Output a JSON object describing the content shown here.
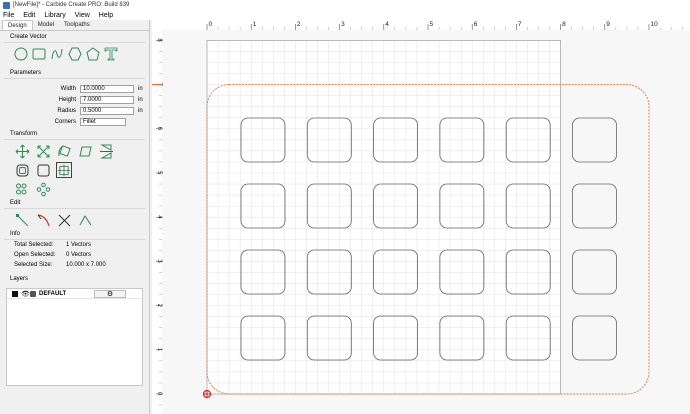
{
  "window": {
    "title": "[NewFile]* - Carbide Create PRO: Build 839"
  },
  "menu": [
    "File",
    "Edit",
    "Library",
    "View",
    "Help"
  ],
  "tabs": [
    "Design",
    "Model",
    "Toolpaths"
  ],
  "create_vector": {
    "title": "Create Vector",
    "icons": [
      "circle-icon",
      "rounded-rectangle-icon",
      "curve-icon",
      "polygon-icon",
      "pentagon-icon",
      "text-icon"
    ]
  },
  "parameters": {
    "title": "Parameters",
    "fields": [
      {
        "label": "Width",
        "value": "10.0000",
        "unit": "in"
      },
      {
        "label": "Height",
        "value": "7.0000",
        "unit": "in"
      },
      {
        "label": "Radius",
        "value": "0.5000",
        "unit": "in"
      }
    ],
    "corners_label": "Corners",
    "corners_value": "Fillet"
  },
  "transform": {
    "title": "Transform",
    "row1": [
      "move-icon",
      "scale-icon",
      "rotate-icon",
      "skew-icon",
      "mirror-icon"
    ],
    "row2": [
      "offset-icon",
      "boolean-icon",
      "align-icon"
    ],
    "row3": [
      "array-icon"
    ]
  },
  "edit": {
    "title": "Edit",
    "icons": [
      "node-edit-icon",
      "knife-icon",
      "trim-icon",
      "join-icon"
    ]
  },
  "info": {
    "title": "Info",
    "lines": [
      {
        "key": "Total Selected:",
        "value": "1 Vectors"
      },
      {
        "key": "Open Selected:",
        "value": "0 Vectors"
      },
      {
        "key": "Selected Size:",
        "value": "10.000 x 7.000"
      }
    ]
  },
  "layers": {
    "title": "Layers",
    "items": [
      {
        "name": "DEFAULT",
        "color": "#111111"
      }
    ]
  },
  "ruler": {
    "h_labels": [
      "0",
      "1",
      "2",
      "3",
      "4",
      "5",
      "6",
      "7",
      "8",
      "9",
      "10"
    ],
    "v_labels": [
      "8",
      "7",
      "6",
      "5",
      "4",
      "3",
      "2",
      "1",
      "0"
    ]
  },
  "colors": {
    "selection": "#e8743b",
    "grid": "#d9d9d9",
    "stock": "#a9a9a9",
    "origin": "#d22222"
  }
}
